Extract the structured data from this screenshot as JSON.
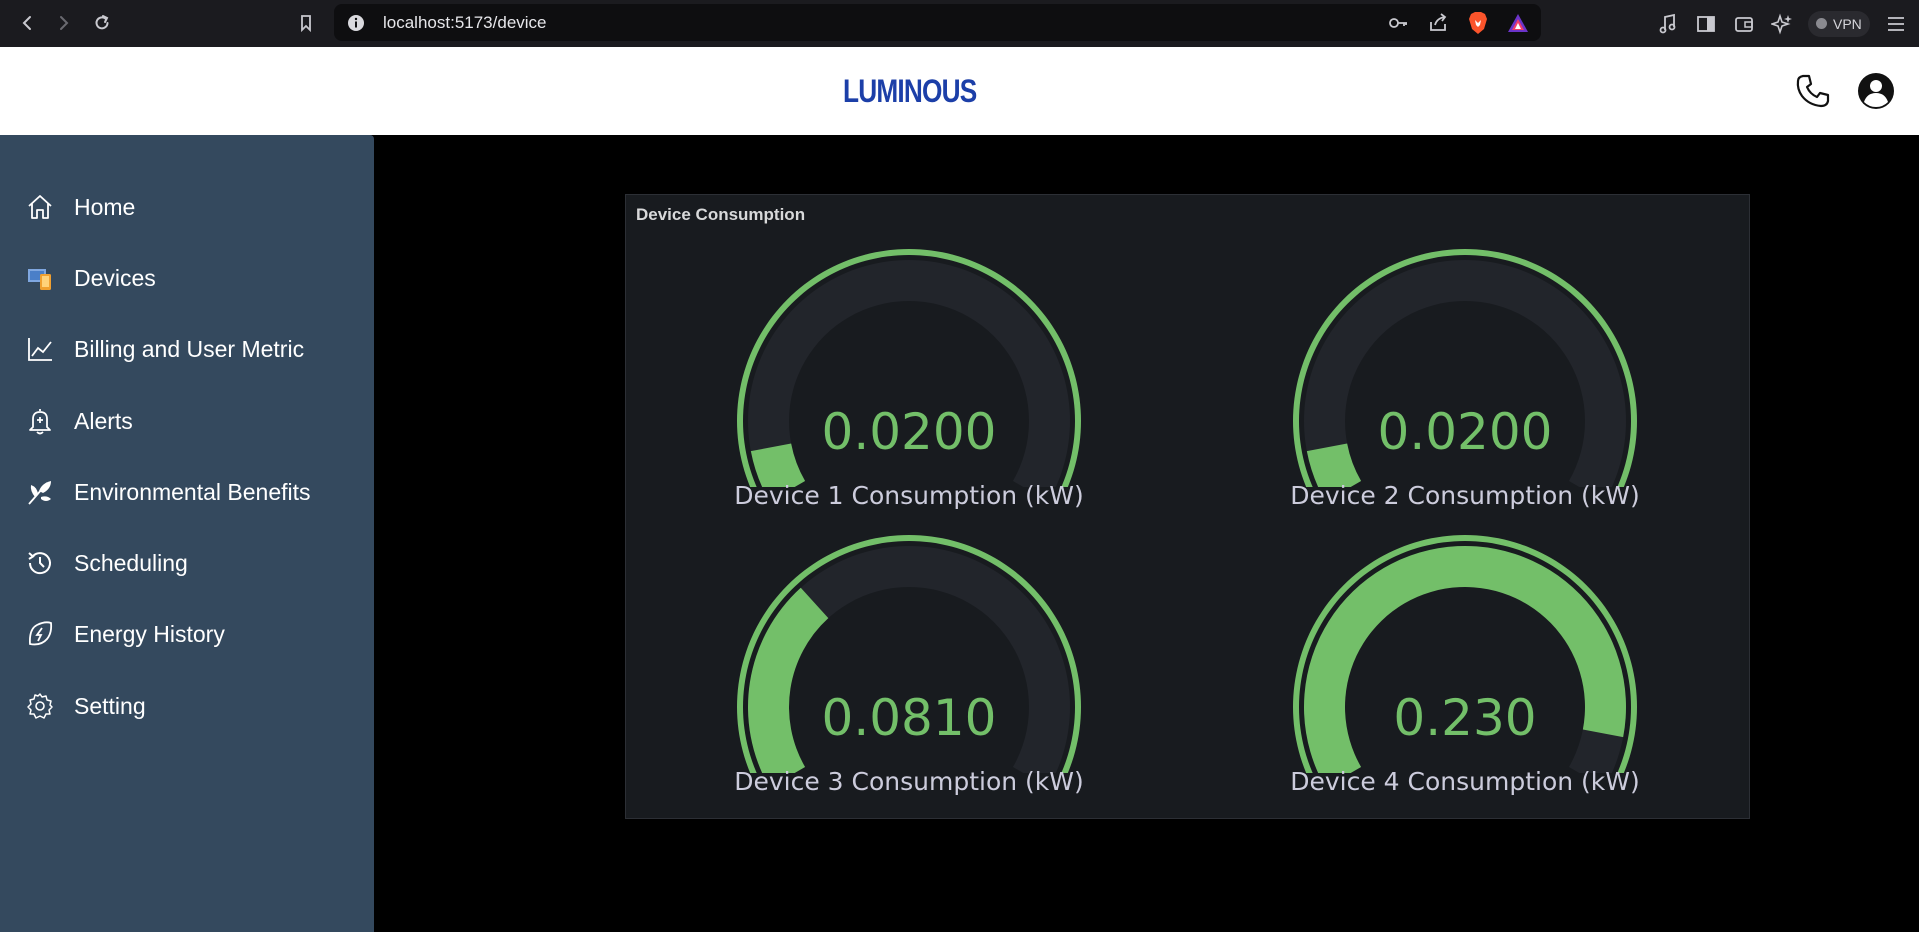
{
  "browser": {
    "url": "localhost:5173/device",
    "vpn_label": "VPN"
  },
  "header": {
    "logo_text": "LUMINOUS"
  },
  "sidebar": {
    "items": [
      {
        "label": "Home",
        "icon": "home-icon"
      },
      {
        "label": "Devices",
        "icon": "devices-icon"
      },
      {
        "label": "Billing and User Metric",
        "icon": "chart-line-icon"
      },
      {
        "label": "Alerts",
        "icon": "bell-icon"
      },
      {
        "label": "Environmental Benefits",
        "icon": "leaf-icon"
      },
      {
        "label": "Scheduling",
        "icon": "history-icon"
      },
      {
        "label": "Energy History",
        "icon": "energy-leaf-icon"
      },
      {
        "label": "Setting",
        "icon": "gear-icon"
      }
    ]
  },
  "panel": {
    "title": "Device Consumption"
  },
  "chart_data": {
    "type": "gauge",
    "min": 0,
    "max": 0.25,
    "colors": {
      "value": "#73bf69",
      "track": "#22252b",
      "text": "#ccccdc"
    },
    "gauges": [
      {
        "name": "Device 1 Consumption (kW)",
        "value": 0.02,
        "display": "0.0200"
      },
      {
        "name": "Device 2 Consumption (kW)",
        "value": 0.02,
        "display": "0.0200"
      },
      {
        "name": "Device 3 Consumption (kW)",
        "value": 0.081,
        "display": "0.0810"
      },
      {
        "name": "Device 4 Consumption (kW)",
        "value": 0.23,
        "display": "0.230"
      }
    ]
  }
}
